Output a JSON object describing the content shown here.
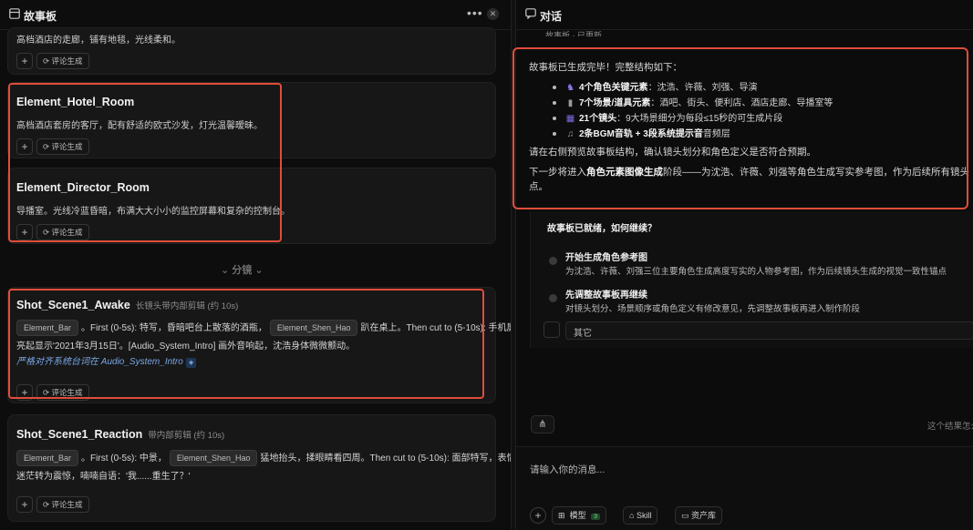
{
  "left_panel": {
    "title": "故事板",
    "more_icon": "more-horizontal-icon",
    "close_icon": "close-icon",
    "top_card": {
      "desc": "高档酒店的走廊，铺有地毯，光线柔和。",
      "generate_label": "评论生成"
    },
    "cards": [
      {
        "title": "Element_Hotel_Room",
        "desc": "高档酒店套房的客厅，配有舒适的欧式沙发，灯光温馨暧昧。",
        "generate_label": "评论生成"
      },
      {
        "title": "Element_Director_Room",
        "desc": "导播室。光线冷蓝昏暗，布满大大小小的监控屏幕和复杂的控制台。",
        "generate_label": "评论生成"
      }
    ],
    "divider": "分镜",
    "shots": [
      {
        "title": "Shot_Scene1_Awake",
        "subtitle": "长镜头带内部剪辑 (约 10s)",
        "chip1": "Element_Bar",
        "text1": "。First (0-5s): 特写，昏暗吧台上散落的酒瓶，",
        "chip2": "Element_Shen_Hao",
        "text2": "趴在桌上。Then cut to (5-10s): 手机屏幕",
        "line2": "亮起显示'2021年3月15日'。[Audio_System_Intro] 画外音响起，沈浩身体微微颤动。",
        "note": "严格对齐系统台词在 Audio_System_Intro",
        "note_badge": "◈",
        "generate_label": "评论生成"
      },
      {
        "title": "Shot_Scene1_Reaction",
        "subtitle": "带内部剪辑 (约 10s)",
        "chip1": "Element_Bar",
        "text1": "。First (0-5s): 中景，",
        "chip2": "Element_Shen_Hao",
        "text2": "猛地抬头，揉眼睛看四周。Then cut to (5-10s): 面部特写，表情从",
        "line2": "迷茫转为震惊，喃喃自语：'我......重生了？'",
        "generate_label": "评论生成"
      }
    ]
  },
  "right_panel": {
    "title": "对话",
    "prev_line": "故事板 · 已更新",
    "message": {
      "intro": "故事板已生成完毕！完整结构如下：",
      "bullets": [
        {
          "icon": "person-icon",
          "bold": "4个角色关键元素",
          "rest": "：沈浩、许薇、刘强、导演"
        },
        {
          "icon": "building-icon",
          "bold": "7个场景/道具元素",
          "rest": "：酒吧、街头、便利店、酒店走廊、导播室等"
        },
        {
          "icon": "film-icon",
          "bold": "21个镜头",
          "rest": "：9大场景细分为每段≤15秒的可生成片段"
        },
        {
          "icon": "music-icon",
          "bold": "2条BGM音轨 + 3段系统提示音",
          "rest": "音频层"
        }
      ],
      "para1": "请在右侧预览故事板结构，确认镜头划分和角色定义是否符合预期。",
      "para2_pre": "下一步将进入",
      "para2_bold": "角色元素图像生成",
      "para2_post": "阶段——为沈浩、许薇、刘强等角色生成写实参考图，作为后续所有镜头",
      "para2_wrap": "点。"
    },
    "question": {
      "title": "故事板已就绪，如何继续？",
      "options": [
        {
          "title": "开始生成角色参考图",
          "desc": "为沈浩、许薇、刘强三位主要角色生成高度写实的人物参考图，作为后续镜头生成的视觉一致性锚点"
        },
        {
          "title": "先调整故事板再继续",
          "desc": "对镜头划分、场景顺序或角色定义有修改意见，先调整故事板再进入制作阶段"
        }
      ],
      "other_label": "其它"
    },
    "footer_hint": "这个结果怎么",
    "input_placeholder": "请输入你的消息...",
    "toolbar": {
      "model_label": "模型",
      "model_badge": "3",
      "skill_label": "Skill",
      "assets_label": "资产库"
    },
    "accent_color": "#e04d3a"
  }
}
